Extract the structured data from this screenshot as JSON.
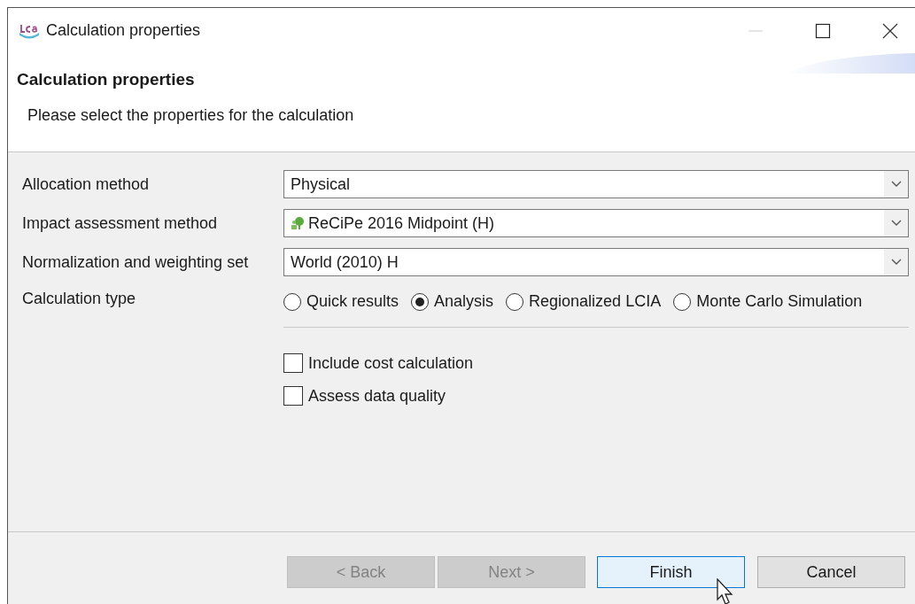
{
  "window": {
    "title": "Calculation properties"
  },
  "header": {
    "title": "Calculation properties",
    "description": "Please select the properties for the calculation"
  },
  "fields": [
    {
      "label": "Allocation method",
      "value": "Physical",
      "kind": "plain"
    },
    {
      "label": "Impact assessment method",
      "value": "ReCiPe 2016 Midpoint (H)",
      "kind": "method"
    },
    {
      "label": "Normalization and weighting set",
      "value": "World (2010) H",
      "kind": "plain"
    }
  ],
  "calculation_type": {
    "label": "Calculation type",
    "options": [
      {
        "label": "Quick results",
        "selected": false
      },
      {
        "label": "Analysis",
        "selected": true
      },
      {
        "label": "Regionalized LCIA",
        "selected": false
      },
      {
        "label": "Monte Carlo Simulation",
        "selected": false
      }
    ]
  },
  "checkboxes": [
    {
      "label": "Include cost calculation",
      "checked": false
    },
    {
      "label": "Assess data quality",
      "checked": false
    }
  ],
  "buttons": [
    {
      "label": "< Back",
      "disabled": true,
      "focused": false
    },
    {
      "label": "Next >",
      "disabled": true,
      "focused": false
    },
    {
      "label": "Finish",
      "disabled": false,
      "focused": true
    },
    {
      "label": "Cancel",
      "disabled": false,
      "focused": false
    }
  ]
}
